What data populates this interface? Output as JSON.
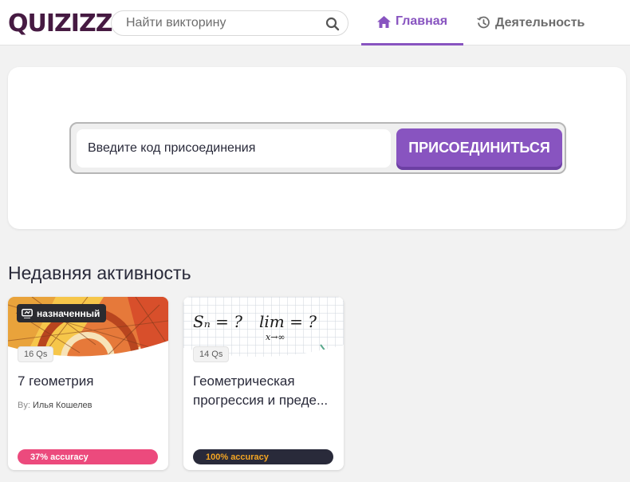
{
  "header": {
    "logo_text": "QUIZIZZ",
    "search": {
      "placeholder": "Найти викторину",
      "value": "",
      "icon": "search-icon"
    },
    "tabs": [
      {
        "label": "Главная",
        "icon": "home-icon",
        "active": true
      },
      {
        "label": "Деятельность",
        "icon": "history-icon",
        "active": false
      }
    ]
  },
  "join": {
    "input_placeholder": "Введите код присоединения",
    "input_value": "",
    "button_label": "ПРИСОЕДИНИТЬСЯ"
  },
  "recent": {
    "title": "Недавняя активность",
    "cards": [
      {
        "badge": "назначенный",
        "badge_icon": "assignment-icon",
        "questions": "16 Qs",
        "title": "7 геометрия",
        "author_prefix": "By:",
        "author": "Илья Кошелев",
        "accuracy_label": "37% accuracy",
        "accuracy": 0.37
      },
      {
        "questions": "14 Qs",
        "title": "Геометрическая прогрессия и преде...",
        "thumb_text_left": "Sₙ = ?",
        "thumb_text_right": "lim = ?",
        "thumb_text_sub": "x→∞",
        "accuracy_label": "100% accuracy",
        "accuracy": 1.0
      }
    ]
  },
  "colors": {
    "brand": "#8854c0",
    "logo": "#461a42",
    "accuracy_low": "#ec4a7d",
    "accuracy_high_bg": "#292a3a",
    "accuracy_high_text": "#f5a623"
  }
}
